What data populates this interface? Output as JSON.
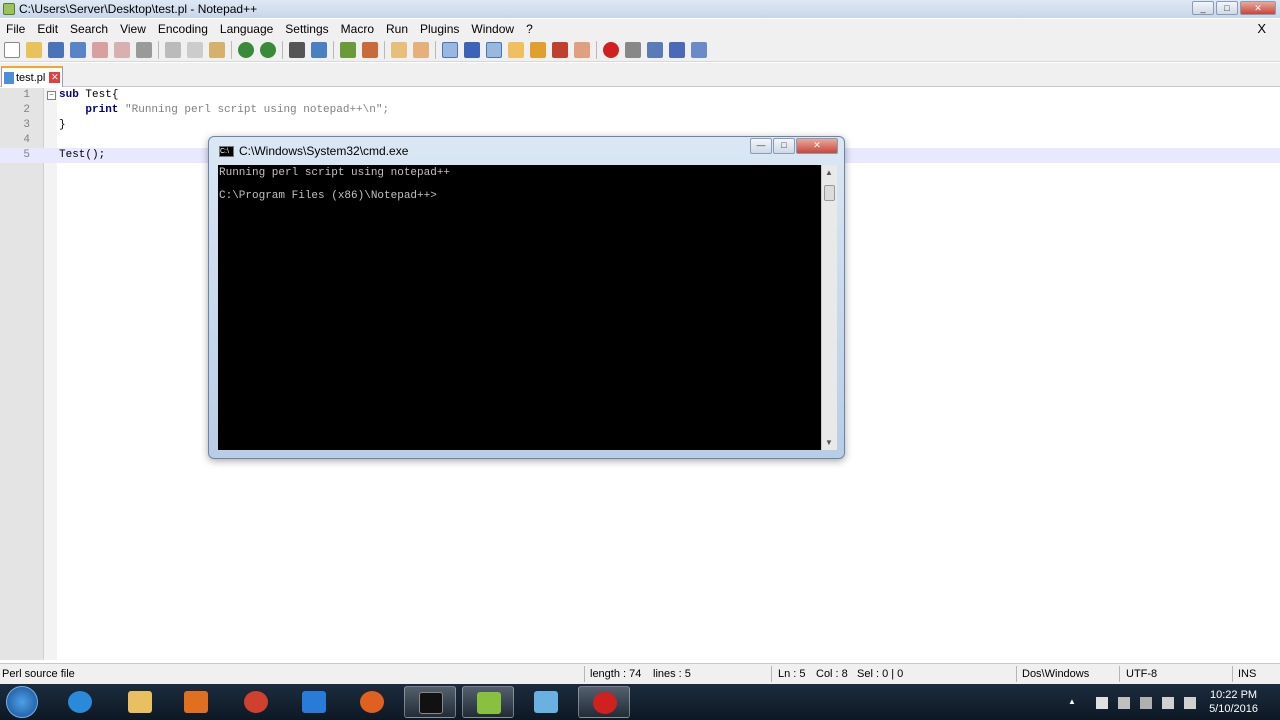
{
  "window": {
    "title": "C:\\Users\\Server\\Desktop\\test.pl - Notepad++",
    "min": "_",
    "max": "□",
    "close": "✕"
  },
  "menu": {
    "items": [
      "File",
      "Edit",
      "Search",
      "View",
      "Encoding",
      "Language",
      "Settings",
      "Macro",
      "Run",
      "Plugins",
      "Window",
      "?"
    ],
    "close_x": "X"
  },
  "tab": {
    "label": "test.pl",
    "close": "✕"
  },
  "editor": {
    "line_numbers": [
      "1",
      "2",
      "3",
      "4",
      "5"
    ],
    "lines": [
      {
        "kw": "sub",
        "rest": " Test{"
      },
      {
        "kw": "    print",
        "rest": " \"Running perl script using notepad++\\n\";"
      },
      {
        "kw": "",
        "rest": "}"
      },
      {
        "kw": "",
        "rest": ""
      },
      {
        "kw": "",
        "rest": "Test();"
      }
    ]
  },
  "cmd": {
    "title": "C:\\Windows\\System32\\cmd.exe",
    "output_line1": "Running perl script using notepad++",
    "output_line2": "C:\\Program Files (x86)\\Notepad++>",
    "min": "—",
    "max": "□",
    "close": "✕"
  },
  "status": {
    "file_type": "Perl source file",
    "length": "length : 74",
    "lines": "lines : 5",
    "ln": "Ln : 5",
    "col": "Col : 8",
    "sel": "Sel : 0 | 0",
    "eol": "Dos\\Windows",
    "encoding": "UTF-8",
    "mode": "INS"
  },
  "taskbar": {
    "time": "10:22 PM",
    "date": "5/10/2016"
  }
}
